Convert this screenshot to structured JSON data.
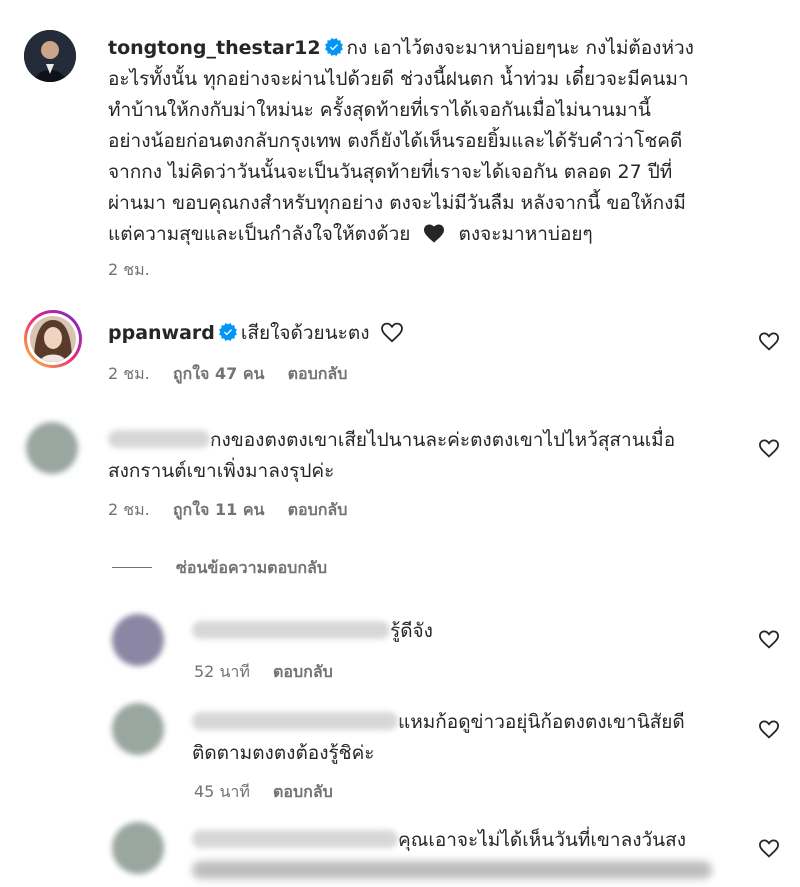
{
  "comments": [
    {
      "username": "tongtong_thestar12",
      "verified": true,
      "lines": [
        "กง เอาไว้ตงจะมาหาบ่อยๆนะ กงไม่ต้องห่วง",
        "อะไรทั้งนั้น ทุกอย่างจะผ่านไปด้วยดี ช่วงนี้ฝนตก น้ำท่วม เดี๋ยวจะมีคนมา",
        "ทำบ้านให้กงกับม่าใหม่นะ ครั้งสุดท้ายที่เราได้เจอกันเมื่อไม่นานมานี้",
        "อย่างน้อยก่อนตงกลับกรุงเทพ ตงก็ยังได้เห็นรอยยิ้มและได้รับคำว่าโชคดี",
        "จากกง ไม่คิดว่าวันนั้นจะเป็นวันสุดท้ายที่เราจะได้เจอกัน ตลอด 27 ปีที่",
        "ผ่านมา ขอบคุณกงสำหรับทุกอย่าง ตงจะไม่มีวันลืม หลังจากนี้ ขอให้กงมี",
        "แต่ความสุขและเป็นกำลังใจให้ตงด้วย",
        "ตงจะมาหาบ่อยๆ"
      ],
      "time": "2 ชม."
    },
    {
      "username": "ppanward",
      "verified": true,
      "text": "เสียใจด้วยนะตง",
      "time": "2 ชม.",
      "likes": "ถูกใจ 47 คน",
      "reply": "ตอบกลับ"
    },
    {
      "lines": [
        "กงของตงตงเขาเสียไปนานละค่ะตงตงเขาไปไหว้สุสานเมื่อ",
        "สงกรานต์เขาเพิ่งมาลงรุปค่ะ"
      ],
      "time": "2 ชม.",
      "likes": "ถูกใจ 11 คน",
      "reply": "ตอบกลับ"
    }
  ],
  "hide_replies": "ซ่อนข้อความตอบกลับ",
  "replies": [
    {
      "lines": [
        "รู้ดีจัง"
      ],
      "time": "52 นาที",
      "reply": "ตอบกลับ"
    },
    {
      "lines": [
        "แหมก้อดูข่าวอยุ่นิก้อตงตงเขานิสัยดี",
        "ติดตามตงตงต้องรู้ชิค่ะ"
      ],
      "time": "45 นาที",
      "reply": "ตอบกลับ"
    },
    {
      "lines": [
        "คุณเอาจะไม่ได้เห็นวันที่เขาลงวันสง"
      ]
    }
  ],
  "icons": {
    "verified": "verified-badge-icon",
    "like": "heart-outline-icon",
    "emoji_heart": "black-heart-emoji"
  },
  "colors": {
    "verified": "#0095f6",
    "avatar_ring_start": "#f9ce34",
    "avatar_ring_mid": "#ee2a7b",
    "avatar_ring_end": "#6228d7"
  }
}
